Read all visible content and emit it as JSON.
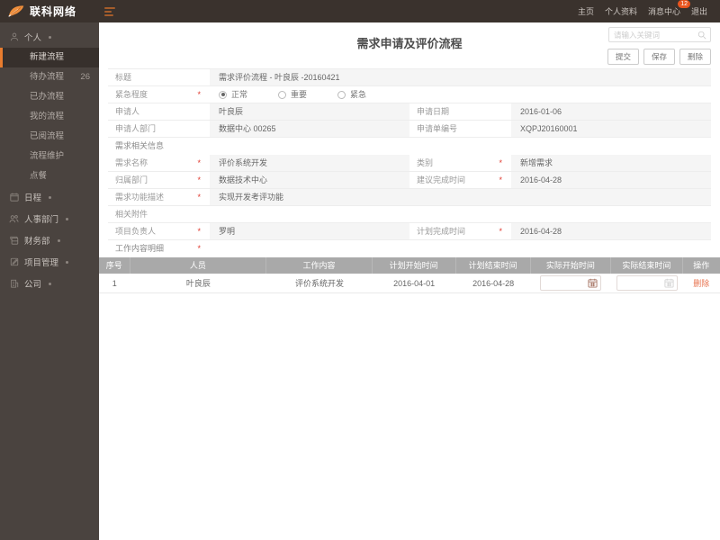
{
  "topbar": {
    "brand": "联科网络",
    "nav": [
      {
        "label": "主页"
      },
      {
        "label": "个人资料"
      },
      {
        "label": "消息中心",
        "badge": "12"
      },
      {
        "label": "退出"
      }
    ]
  },
  "sidebar": {
    "groups": [
      {
        "label": "个人",
        "icon": "user-icon",
        "children": [
          {
            "label": "新建流程"
          },
          {
            "label": "待办流程",
            "badge": "26"
          },
          {
            "label": "已办流程"
          },
          {
            "label": "我的流程"
          },
          {
            "label": "已阅流程"
          },
          {
            "label": "流程维护"
          },
          {
            "label": "点餐"
          }
        ]
      },
      {
        "label": "日程",
        "icon": "calendar-icon"
      },
      {
        "label": "人事部门",
        "icon": "people-icon"
      },
      {
        "label": "财务部",
        "icon": "finance-icon"
      },
      {
        "label": "项目管理",
        "icon": "project-icon"
      },
      {
        "label": "公司",
        "icon": "company-icon"
      }
    ]
  },
  "header": {
    "title": "需求申请及评价流程",
    "search": {
      "placeholder": "请输入关键词"
    },
    "buttons": {
      "submit": "提交",
      "save": "保存",
      "delete": "删除"
    }
  },
  "form": {
    "required_mark": "*",
    "title": {
      "label": "标题",
      "value": "需求评价流程 - 叶良辰 -20160421"
    },
    "urgency": {
      "label": "紧急程度",
      "options": [
        {
          "label": "正常",
          "selected": true
        },
        {
          "label": "重要",
          "selected": false
        },
        {
          "label": "紧急",
          "selected": false
        }
      ]
    },
    "applicant": {
      "label": "申请人",
      "value": "叶良辰"
    },
    "apply_date": {
      "label": "申请日期",
      "value": "2016-01-06"
    },
    "applicant_dept": {
      "label": "申请人部门",
      "value": "数据中心 00265"
    },
    "apply_no": {
      "label": "申请单编号",
      "value": "XQPJ20160001"
    },
    "section_demand": "需求相关信息",
    "demand_name": {
      "label": "需求名称",
      "value": "评价系统开发"
    },
    "category": {
      "label": "类别",
      "value": "新增需求"
    },
    "owner_dept": {
      "label": "归属部门",
      "value": "数据技术中心"
    },
    "suggest_finish": {
      "label": "建议完成时间",
      "value": "2016-04-28"
    },
    "demand_desc": {
      "label": "需求功能描述",
      "value": "实现开发考评功能"
    },
    "attachment": {
      "label": "相关附件",
      "value": ""
    },
    "project_owner": {
      "label": "项目负责人",
      "value": "罗明"
    },
    "plan_finish": {
      "label": "计划完成时间",
      "value": "2016-04-28"
    },
    "section_detail": "工作内容明细"
  },
  "work_table": {
    "headers": [
      "序号",
      "人员",
      "工作内容",
      "计划开始时间",
      "计划结束时间",
      "实际开始时间",
      "实际结束时间",
      "操作"
    ],
    "rows": [
      {
        "no": "1",
        "person": "叶良辰",
        "content": "评价系统开发",
        "plan_start": "2016-04-01",
        "plan_end": "2016-04-28",
        "actual_start": "",
        "actual_end": "",
        "action": "删除"
      }
    ]
  },
  "colors": {
    "accent_orange": "#ef8f3c",
    "badge_red": "#e8541e",
    "required_red": "#e03a2f",
    "table_header_bg": "#a9a9a9",
    "delete_link": "#e87450",
    "topbar_bg": "#3a322d",
    "sidebar_bg": "#4a433f"
  }
}
